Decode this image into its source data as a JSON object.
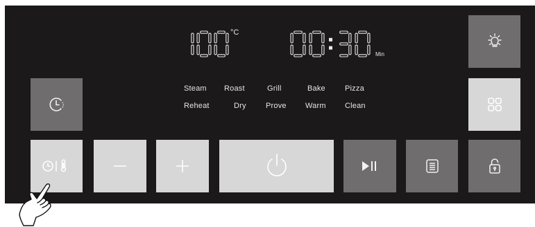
{
  "display": {
    "temperature": "100",
    "temperature_unit": "°C",
    "timer": "00:30",
    "timer_unit": "Min"
  },
  "modes": {
    "row1": [
      "Steam",
      "Roast",
      "Grill",
      "Bake",
      "Pizza"
    ],
    "row2": [
      "Reheat",
      "Dry",
      "Prove",
      "Warm",
      "Clean"
    ]
  },
  "buttons": {
    "light": {
      "icon": "light-bulb-icon"
    },
    "menu": {
      "icon": "four-squares-icon"
    },
    "delay_timer": {
      "icon": "clock-dotted-icon"
    },
    "clock_temp": {
      "icon": "clock-thermometer-icon"
    },
    "minus": {
      "icon": "minus-icon"
    },
    "plus": {
      "icon": "plus-icon"
    },
    "power": {
      "icon": "power-icon"
    },
    "play_pause": {
      "icon": "play-pause-icon"
    },
    "recipe": {
      "icon": "list-icon"
    },
    "lock": {
      "icon": "padlock-icon"
    }
  },
  "colors": {
    "panel": "#1b1919",
    "button_dark": "#6f6d6e",
    "button_light": "#d7d7d7",
    "display": "#e9e9e9"
  }
}
